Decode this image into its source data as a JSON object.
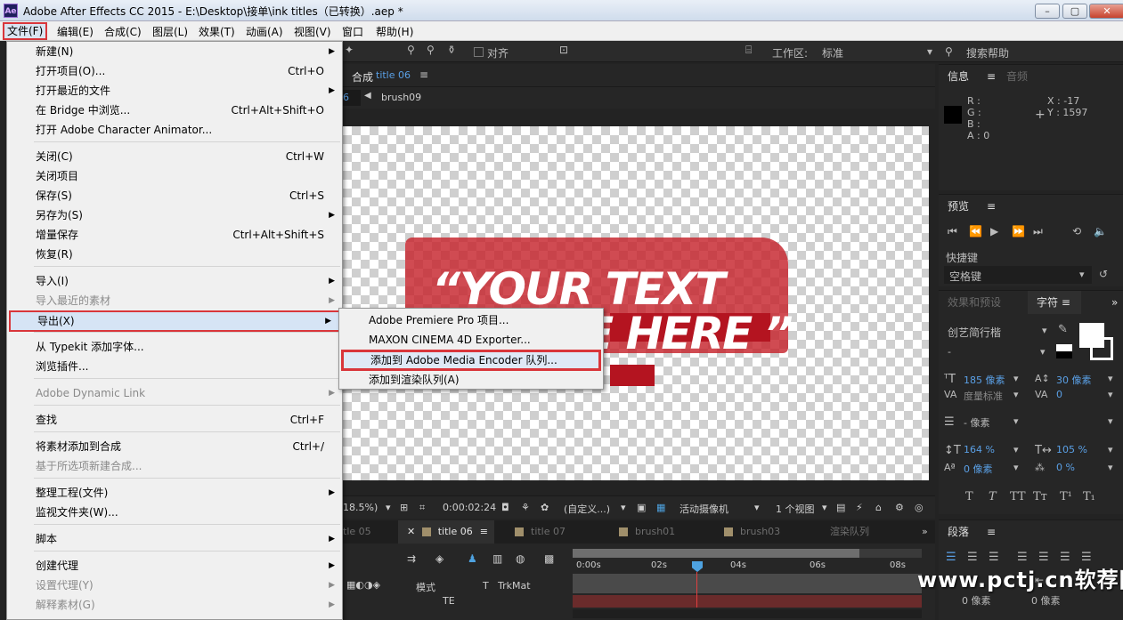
{
  "window": {
    "app_badge": "Ae",
    "title": "Adobe After Effects CC 2015 - E:\\Desktop\\接单\\ink titles（已转换）.aep *",
    "buttons": [
      "–",
      "▢",
      "✕"
    ]
  },
  "menubar": [
    "文件(F)",
    "编辑(E)",
    "合成(C)",
    "图层(L)",
    "效果(T)",
    "动画(A)",
    "视图(V)",
    "窗口",
    "帮助(H)"
  ],
  "toolbar": {
    "align_label": "对齐",
    "workspace_label": "工作区:",
    "workspace_value": "标准",
    "search_label": "搜索帮助"
  },
  "composition": {
    "panel_label": "合成",
    "comp_name": "title 06",
    "breadcrumb_current": "6",
    "breadcrumb_item": "brush09",
    "text_line1": "“YOUR TEXT",
    "text_line2": "E HERE ”",
    "footer": {
      "zoom": "18.5%)",
      "timecode": "0:00:02:24",
      "resolution": "(自定义...)",
      "camera": "活动摄像机",
      "views": "1 个视图"
    }
  },
  "timeline": {
    "tabs": [
      "tle 05",
      "title 06",
      "title 07",
      "brush01",
      "brush03",
      "渲染队列"
    ],
    "col_mode": "模式",
    "col_t": "T",
    "col_trkmat": "TrkMat",
    "ruler": [
      "0:00s",
      "02s",
      "04s",
      "06s",
      "08s"
    ],
    "fx_label": "TE"
  },
  "info_panel": {
    "tab_info": "信息",
    "tab_audio": "音频",
    "r": "R :",
    "g": "G :",
    "b": "B :",
    "a": "A : 0",
    "x": "X : -17",
    "y": "Y : 1597"
  },
  "preview_panel": {
    "tab": "预览",
    "shortcut_label": "快捷键",
    "shortcut_value": "空格键"
  },
  "char_panel": {
    "tab_effects": "效果和预设",
    "tab_char": "字符",
    "font": "创艺简行楷",
    "style": "-",
    "size": "185 像素",
    "leading": "30 像素",
    "kerning": "度量标准",
    "tracking": "0",
    "stroke": "- 像素",
    "vscale": "164 %",
    "hscale": "105 %",
    "baseline": "0 像素",
    "tsume": "0 %",
    "styles": [
      "T",
      "T",
      "TT",
      "Tт",
      "T¹",
      "T₁"
    ]
  },
  "para_panel": {
    "tab": "段落",
    "indent1": "0 像素",
    "indent2": "0 像素"
  },
  "file_menu": [
    {
      "label": "新建(N)",
      "shortcut": "",
      "arrow": true,
      "disabled": false
    },
    {
      "label": "打开项目(O)...",
      "shortcut": "Ctrl+O",
      "arrow": false,
      "disabled": false
    },
    {
      "label": "打开最近的文件",
      "shortcut": "",
      "arrow": true,
      "disabled": false
    },
    {
      "label": "在 Bridge 中浏览...",
      "shortcut": "Ctrl+Alt+Shift+O",
      "arrow": false,
      "disabled": false
    },
    {
      "label": "打开 Adobe Character Animator...",
      "shortcut": "",
      "arrow": false,
      "disabled": false
    },
    {
      "label": "关闭(C)",
      "shortcut": "Ctrl+W",
      "arrow": false,
      "disabled": false
    },
    {
      "label": "关闭项目",
      "shortcut": "",
      "arrow": false,
      "disabled": false
    },
    {
      "label": "保存(S)",
      "shortcut": "Ctrl+S",
      "arrow": false,
      "disabled": false
    },
    {
      "label": "另存为(S)",
      "shortcut": "",
      "arrow": true,
      "disabled": false
    },
    {
      "label": "增量保存",
      "shortcut": "Ctrl+Alt+Shift+S",
      "arrow": false,
      "disabled": false
    },
    {
      "label": "恢复(R)",
      "shortcut": "",
      "arrow": false,
      "disabled": false
    },
    {
      "label": "导入(I)",
      "shortcut": "",
      "arrow": true,
      "disabled": false
    },
    {
      "label": "导入最近的素材",
      "shortcut": "",
      "arrow": true,
      "disabled": true
    },
    {
      "label": "导出(X)",
      "shortcut": "",
      "arrow": true,
      "disabled": false
    },
    {
      "label": "从 Typekit 添加字体...",
      "shortcut": "",
      "arrow": false,
      "disabled": false
    },
    {
      "label": "浏览插件...",
      "shortcut": "",
      "arrow": false,
      "disabled": false
    },
    {
      "label": "Adobe Dynamic Link",
      "shortcut": "",
      "arrow": true,
      "disabled": true
    },
    {
      "label": "查找",
      "shortcut": "Ctrl+F",
      "arrow": false,
      "disabled": false
    },
    {
      "label": "将素材添加到合成",
      "shortcut": "Ctrl+/",
      "arrow": false,
      "disabled": false
    },
    {
      "label": "基于所选项新建合成...",
      "shortcut": "",
      "arrow": false,
      "disabled": true
    },
    {
      "label": "整理工程(文件)",
      "shortcut": "",
      "arrow": true,
      "disabled": false
    },
    {
      "label": "监视文件夹(W)...",
      "shortcut": "",
      "arrow": false,
      "disabled": false
    },
    {
      "label": "脚本",
      "shortcut": "",
      "arrow": true,
      "disabled": false
    },
    {
      "label": "创建代理",
      "shortcut": "",
      "arrow": true,
      "disabled": false
    },
    {
      "label": "设置代理(Y)",
      "shortcut": "",
      "arrow": true,
      "disabled": true
    },
    {
      "label": "解释素材(G)",
      "shortcut": "",
      "arrow": true,
      "disabled": true
    }
  ],
  "export_submenu": [
    "Adobe Premiere Pro 项目...",
    "MAXON CINEMA 4D Exporter...",
    "添加到 Adobe Media Encoder 队列...",
    "添加到渲染队列(A)"
  ],
  "watermark": "www.pctj.cn软荐网"
}
